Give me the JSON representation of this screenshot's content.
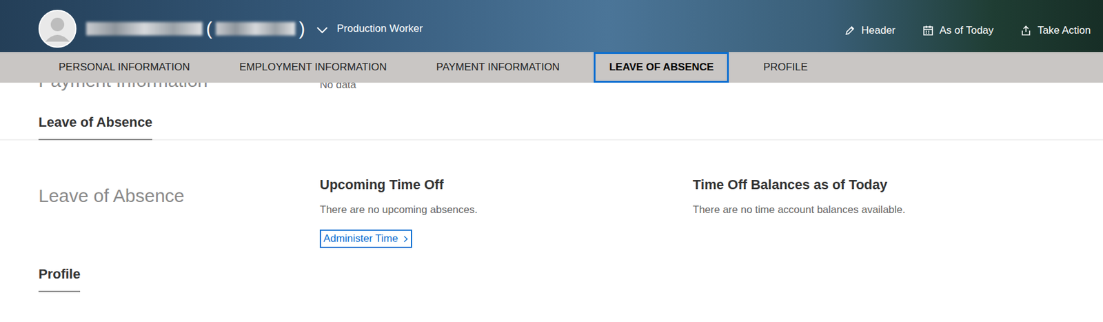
{
  "header": {
    "name_open": "(",
    "name_close": ")",
    "role": "Production Worker",
    "actions": [
      {
        "label": "Header"
      },
      {
        "label": "As of Today"
      },
      {
        "label": "Take Action"
      }
    ]
  },
  "tabs": [
    {
      "label": "PERSONAL INFORMATION",
      "selected": false
    },
    {
      "label": "EMPLOYMENT INFORMATION",
      "selected": false
    },
    {
      "label": "PAYMENT INFORMATION",
      "selected": false
    },
    {
      "label": "LEAVE OF ABSENCE",
      "selected": true
    },
    {
      "label": "PROFILE",
      "selected": false
    }
  ],
  "payment": {
    "title": "Payment Information",
    "value": "No data"
  },
  "leave": {
    "heading": "Leave of Absence",
    "label": "Leave of Absence",
    "upcoming": {
      "title": "Upcoming Time Off",
      "text": "There are no upcoming absences.",
      "link": "Administer Time"
    },
    "balances": {
      "title": "Time Off Balances as of Today",
      "text": "There are no time account balances available."
    }
  },
  "profile": {
    "heading": "Profile"
  }
}
